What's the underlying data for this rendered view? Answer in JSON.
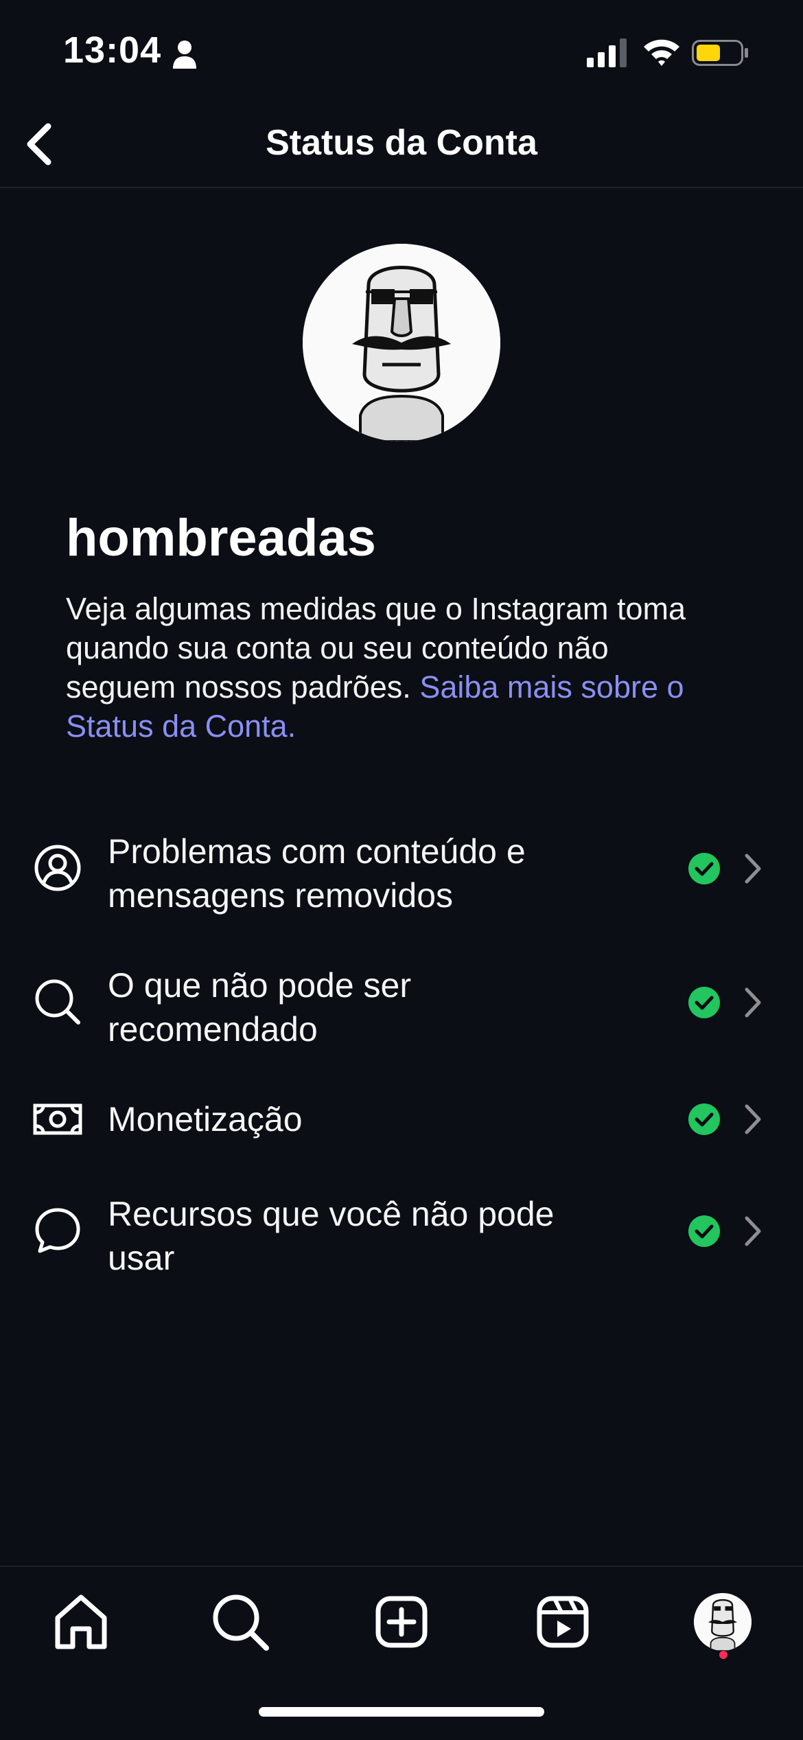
{
  "status_bar": {
    "time": "13:04"
  },
  "header": {
    "title": "Status da Conta"
  },
  "profile": {
    "username": "hombreadas",
    "description": "Veja algumas medidas que o Instagram toma quando sua conta ou seu conteúdo não seguem nossos padrões. ",
    "learn_more": "Saiba mais sobre o Status da Conta."
  },
  "items": [
    {
      "label": "Problemas com conteúdo e mensagens removidos",
      "icon": "person-circle-icon",
      "status": "ok"
    },
    {
      "label": "O que não pode ser recomendado",
      "icon": "search-icon",
      "status": "ok"
    },
    {
      "label": "Monetização",
      "icon": "money-icon",
      "status": "ok"
    },
    {
      "label": "Recursos que você não pode usar",
      "icon": "chat-bubble-icon",
      "status": "ok"
    }
  ],
  "tabbar": {
    "tabs": [
      "home-icon",
      "search-icon",
      "create-icon",
      "reels-icon",
      "profile-avatar"
    ]
  },
  "colors": {
    "accent_link": "#8a8ff2",
    "status_ok": "#22c55e",
    "battery": "#ffd60a",
    "notification": "#ff2d55"
  }
}
